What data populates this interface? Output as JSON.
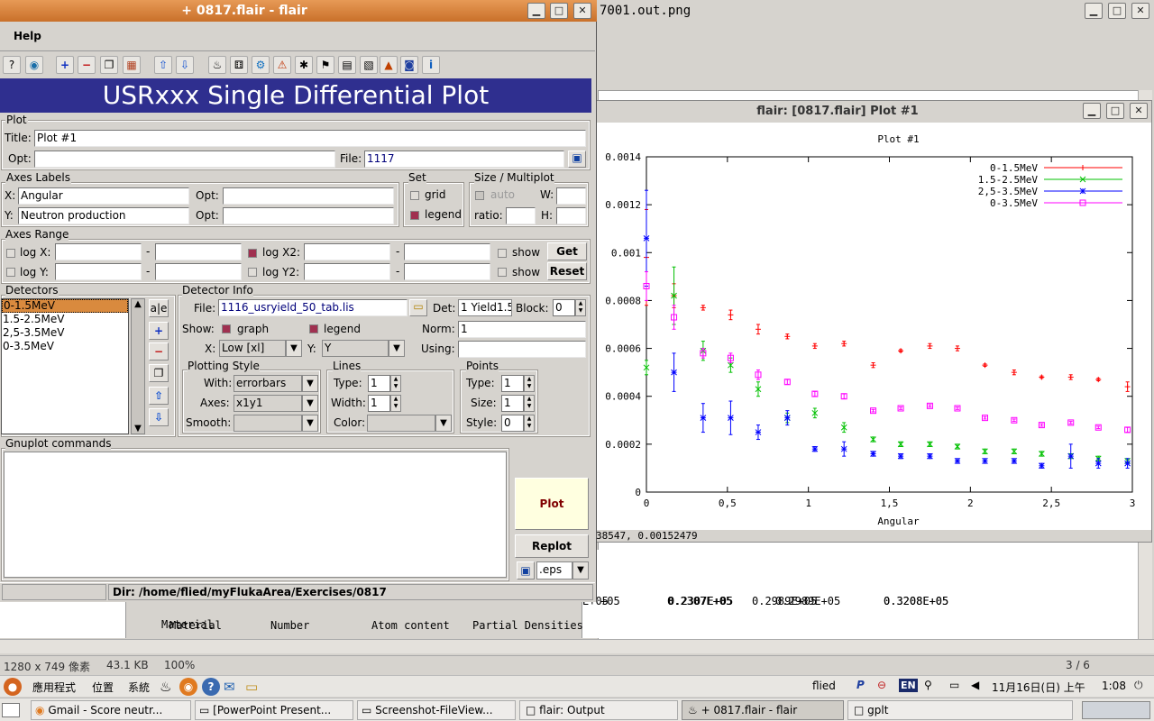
{
  "bg_viewer": {
    "title": "7001.out.png",
    "status": [
      "1280 x 749 像素",
      "43.1 KB",
      "100%"
    ],
    "page": "3 / 6",
    "output_line1": [
      "0.2307E+05",
      "0.2989E+05",
      "0.3208E+05"
    ],
    "output_partial": [
      "E+05",
      "+05"
    ],
    "output_line2": [
      "Material",
      "Number",
      "Atom content",
      "Partial Densities"
    ]
  },
  "plot_window": {
    "title": "flair: [0817.flair] Plot #1",
    "status_text": "38547,  0.00152479"
  },
  "flair": {
    "title": "+ 0817.flair - flair",
    "menu_help": "Help",
    "banner": "USRxxx Single Differential Plot",
    "plot": {
      "section": "Plot",
      "title_label": "Title:",
      "title_value": "Plot #1",
      "opt_label": "Opt:",
      "opt_value": "",
      "file_label": "File:",
      "file_value": "1117"
    },
    "axes_labels": {
      "section": "Axes Labels",
      "x_label": "X:",
      "x_value": "Angular",
      "y_label": "Y:",
      "y_value": "Neutron production",
      "opt_label": "Opt:"
    },
    "set": {
      "section": "Set",
      "grid": "grid",
      "legend": "legend"
    },
    "size": {
      "section": "Size / Multiplot",
      "auto": "auto",
      "w": "W:",
      "ratio": "ratio:",
      "h": "H:"
    },
    "axes_range": {
      "section": "Axes Range",
      "logx": "log X:",
      "logy": "log Y:",
      "logx2": "log X2:",
      "logy2": "log Y2:",
      "dash": "-",
      "show": "show",
      "get": "Get",
      "reset": "Reset"
    },
    "detectors": {
      "section": "Detectors",
      "items": [
        "0-1.5MeV",
        "1.5-2.5MeV",
        "2,5-3.5MeV",
        "0-3.5MeV"
      ]
    },
    "detector_info": {
      "section": "Detector Info",
      "file_label": "File:",
      "file_value": "1116_usryield_50_tab.lis",
      "det_label": "Det:",
      "det_value": "1 Yield1.5",
      "block_label": "Block:",
      "block_value": "0",
      "show_label": "Show:",
      "graph": "graph",
      "legend": "legend",
      "norm_label": "Norm:",
      "norm_value": "1",
      "x_label": "X:",
      "x_value": "Low [xl]",
      "y_label": "Y:",
      "y_value": "Y",
      "using_label": "Using:"
    },
    "plotting_style": {
      "section": "Plotting Style",
      "with_label": "With:",
      "with_value": "errorbars",
      "axes_label": "Axes:",
      "axes_value": "x1y1",
      "smooth_label": "Smooth:"
    },
    "lines": {
      "section": "Lines",
      "type_label": "Type:",
      "type_value": "1",
      "width_label": "Width:",
      "width_value": "1",
      "color_label": "Color:"
    },
    "points": {
      "section": "Points",
      "type_label": "Type:",
      "type_value": "1",
      "size_label": "Size:",
      "size_value": "1",
      "style_label": "Style:",
      "style_value": "0"
    },
    "gnuplot": {
      "section": "Gnuplot commands",
      "plot": "Plot",
      "replot": "Replot",
      "format": ".eps"
    },
    "dir": "Dir: /home/flied/myFlukaArea/Exercises/0817"
  },
  "panel": {
    "menus": [
      "應用程式",
      "位置",
      "系統"
    ],
    "user": "flied",
    "datetime": "11月16日(日) 上午",
    "time": "1:08",
    "lang": "EN"
  },
  "taskbar": [
    "Gmail - Score neutr...",
    "[PowerPoint Present...",
    "Screenshot-FileView...",
    "flair: Output",
    "+ 0817.flair - flair",
    "gplt"
  ],
  "chart_data": {
    "type": "scatter",
    "title": "Plot #1",
    "xlabel": "Angular",
    "ylabel": "",
    "xlim": [
      0,
      3
    ],
    "ylim": [
      0,
      0.0014
    ],
    "x_ticks": [
      0,
      0.5,
      1,
      1.5,
      2,
      2.5,
      3
    ],
    "x_tick_labels": [
      "0",
      "0,5",
      "1",
      "1,5",
      "2",
      "2,5",
      "3"
    ],
    "y_ticks": [
      0,
      0.0002,
      0.0004,
      0.0006,
      0.0008,
      0.001,
      0.0012,
      0.0014
    ],
    "y_tick_labels": [
      "0",
      "0.0002",
      "0.0004",
      "0.0006",
      "0.0008",
      "0.001",
      "0.0012",
      "0.0014"
    ],
    "legend_position": "top-right",
    "grid": false,
    "series": [
      {
        "name": "0-1.5MeV",
        "color": "#ff0000",
        "marker": "+",
        "x": [
          0.0,
          0.17,
          0.35,
          0.52,
          0.69,
          0.87,
          1.04,
          1.22,
          1.4,
          1.57,
          1.75,
          1.92,
          2.09,
          2.27,
          2.44,
          2.62,
          2.79,
          2.97
        ],
        "y": [
          0.00098,
          0.00082,
          0.00077,
          0.00074,
          0.00068,
          0.00065,
          0.00061,
          0.00062,
          0.00053,
          0.00059,
          0.00061,
          0.0006,
          0.00053,
          0.0005,
          0.00048,
          0.00048,
          0.00047,
          0.00044
        ],
        "err": [
          0.0002,
          5e-05,
          1e-05,
          2e-05,
          2e-05,
          1e-05,
          1e-05,
          1e-05,
          1e-05,
          5e-06,
          1e-05,
          1e-05,
          5e-06,
          1e-05,
          5e-06,
          1e-05,
          5e-06,
          2e-05
        ]
      },
      {
        "name": "1.5-2.5MeV",
        "color": "#00c000",
        "marker": "x",
        "x": [
          0.0,
          0.17,
          0.35,
          0.52,
          0.69,
          0.87,
          1.04,
          1.22,
          1.4,
          1.57,
          1.75,
          1.92,
          2.09,
          2.27,
          2.44,
          2.62,
          2.79,
          2.97
        ],
        "y": [
          0.00052,
          0.00082,
          0.00059,
          0.00053,
          0.00043,
          0.00031,
          0.00033,
          0.00027,
          0.00022,
          0.0002,
          0.0002,
          0.00019,
          0.00017,
          0.00017,
          0.00016,
          0.00015,
          0.00014,
          0.00013
        ],
        "err": [
          3e-05,
          0.00012,
          4e-05,
          3e-05,
          3e-05,
          2e-05,
          2e-05,
          2e-05,
          1e-05,
          1e-05,
          1e-05,
          1e-05,
          1e-05,
          1e-05,
          1e-05,
          1e-05,
          1e-05,
          1e-05
        ]
      },
      {
        "name": "2,5-3.5MeV",
        "color": "#0000ff",
        "marker": "*",
        "x": [
          0.0,
          0.17,
          0.35,
          0.52,
          0.69,
          0.87,
          1.04,
          1.22,
          1.4,
          1.57,
          1.75,
          1.92,
          2.09,
          2.27,
          2.44,
          2.62,
          2.79,
          2.97
        ],
        "y": [
          0.00106,
          0.0005,
          0.00031,
          0.00031,
          0.00025,
          0.00031,
          0.00018,
          0.00018,
          0.00016,
          0.00015,
          0.00015,
          0.00013,
          0.00013,
          0.00013,
          0.00011,
          0.00015,
          0.00012,
          0.00012
        ],
        "err": [
          0.0002,
          8e-05,
          6e-05,
          7e-05,
          3e-05,
          3e-05,
          1e-05,
          3e-05,
          1e-05,
          1e-05,
          1e-05,
          1e-05,
          1e-05,
          1e-05,
          1e-05,
          5e-05,
          2e-05,
          2e-05
        ]
      },
      {
        "name": "0-3.5MeV",
        "color": "#ff00ff",
        "marker": "square",
        "x": [
          0.0,
          0.17,
          0.35,
          0.52,
          0.69,
          0.87,
          1.04,
          1.22,
          1.4,
          1.57,
          1.75,
          1.92,
          2.09,
          2.27,
          2.44,
          2.62,
          2.79,
          2.97
        ],
        "y": [
          0.00086,
          0.00073,
          0.00058,
          0.00056,
          0.00049,
          0.00046,
          0.00041,
          0.0004,
          0.00034,
          0.00035,
          0.00036,
          0.00035,
          0.00031,
          0.0003,
          0.00028,
          0.00029,
          0.00027,
          0.00026
        ],
        "err": [
          6e-05,
          5e-05,
          2e-05,
          2e-05,
          2e-05,
          1e-05,
          1e-05,
          1e-05,
          5e-06,
          5e-06,
          5e-06,
          5e-06,
          5e-06,
          5e-06,
          5e-06,
          5e-06,
          5e-06,
          1e-05
        ]
      }
    ]
  }
}
